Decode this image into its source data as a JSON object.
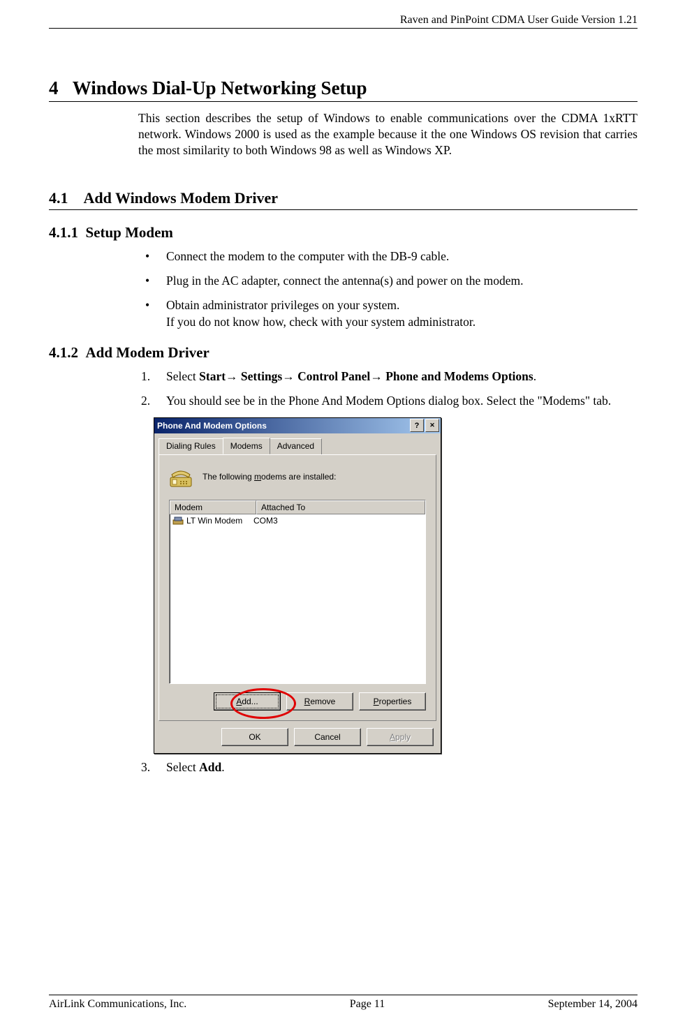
{
  "header": {
    "running": "Raven and PinPoint CDMA User Guide Version 1.21"
  },
  "sections": {
    "h1_num": "4",
    "h1_title": "Windows Dial-Up Networking Setup",
    "intro": "This section describes the setup of Windows to enable communications over the CDMA 1xRTT network. Windows 2000 is used as the example because it the one Windows OS revision that carries the most similarity to both Windows 98 as well as Windows XP.",
    "h2_num": "4.1",
    "h2_title": "Add Windows Modem Driver",
    "h3a_num": "4.1.1",
    "h3a_title": "Setup Modem",
    "bullets": [
      "Connect the modem to the computer with the DB-9 cable.",
      "Plug in the AC adapter, connect the antenna(s) and power on the modem.",
      "Obtain administrator privileges on your system.\nIf you do not know how, check with your system administrator."
    ],
    "h3b_num": "4.1.2",
    "h3b_title": "Add Modem Driver",
    "step1_pre": "Select ",
    "step1_b1": "Start",
    "step1_b2": "Settings",
    "step1_b3": "Control Panel",
    "step1_b4": "Phone and Modems Options",
    "step2": "You should see be in the Phone And Modem Options dialog box. Select the \"Modems\" tab.",
    "step3_pre": "Select ",
    "step3_bold": "Add",
    "step3_post": "."
  },
  "dialog": {
    "title": "Phone And Modem Options",
    "help_glyph": "?",
    "close_glyph": "✕",
    "tabs": {
      "t1": "Dialing Rules",
      "t2": "Modems",
      "t3": "Advanced"
    },
    "info_text_pre": "The following ",
    "info_text_u": "m",
    "info_text_post": "odems are  installed:",
    "columns": {
      "c1": "Modem",
      "c2": "Attached To"
    },
    "row": {
      "name": "LT Win Modem",
      "port": "COM3"
    },
    "buttons": {
      "add_u": "A",
      "add_post": "dd...",
      "remove_u": "R",
      "remove_post": "emove",
      "props_u": "P",
      "props_post": "roperties",
      "ok": "OK",
      "cancel": "Cancel",
      "apply_u": "A",
      "apply_post": "pply"
    }
  },
  "footer": {
    "left": "AirLink Communications, Inc.",
    "center": "Page 11",
    "right": "September 14, 2004"
  }
}
